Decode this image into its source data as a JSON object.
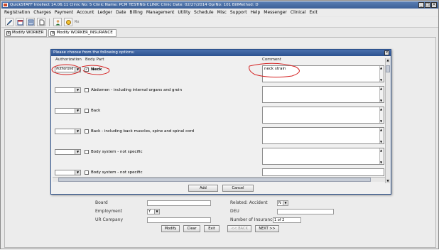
{
  "window": {
    "title": "QuickSTAFF Intellect 14.06.11 Clinic No: 5 Clinic Name: PCM TESTING CLINIC Clinic Date: 02/27/2014 OprNo: 101 BillMethod: D",
    "controls": [
      "_",
      "□",
      "×"
    ]
  },
  "menu": [
    "Registration",
    "Charges",
    "Payment",
    "Account",
    "Ledger",
    "Date",
    "Billing",
    "Management",
    "Utility",
    "Schedule",
    "Misc",
    "Support",
    "Help",
    "Messenger",
    "Clinical",
    "Exit"
  ],
  "toolbar": {
    "icons": [
      "pen-icon",
      "calendar-icon",
      "ledger-icon",
      "document-icon",
      "person-icon",
      "coins-icon"
    ],
    "extra_label": "Rx"
  },
  "tabs": [
    {
      "label": "Modify WORKER",
      "active": false
    },
    {
      "label": "Modify WORKER_INSURANCE",
      "active": true
    }
  ],
  "background_form": {
    "board_label": "Board",
    "related_accident_label": "Related: Accident",
    "related_accident_value": "N",
    "employment_label": "Employment",
    "employment_value": "Y",
    "deu_label": "DEU",
    "ur_company_label": "UR Company",
    "number_insurance_label": "Number of Insurance",
    "number_insurance_value": "1 of 2",
    "buttons": {
      "modify": "Modify",
      "clear": "Clear",
      "exit": "Exit",
      "back": "<< BACK",
      "next": "NEXT >>"
    }
  },
  "dialog": {
    "title": "Please choose from the following options:",
    "header_authorization": "Authorization",
    "header_body_part": "Body Part",
    "header_comment": "Comment",
    "rows": [
      {
        "authorization": "Authorized",
        "checked": true,
        "body_part": "Neck",
        "comment": "neck strain"
      },
      {
        "authorization": "",
        "checked": false,
        "body_part": "Abdomen - including internal organs and groin",
        "comment": ""
      },
      {
        "authorization": "",
        "checked": false,
        "body_part": "Back",
        "comment": ""
      },
      {
        "authorization": "",
        "checked": false,
        "body_part": "Back - including back muscles, spine and spinal cord",
        "comment": ""
      },
      {
        "authorization": "",
        "checked": false,
        "body_part": "Body system - not specific",
        "comment": ""
      },
      {
        "authorization": "",
        "checked": false,
        "body_part": "Body system - not specific",
        "comment": ""
      }
    ],
    "add_label": "Add",
    "cancel_label": "Cancel"
  },
  "colors": {
    "annotation_red": "#d42020",
    "title_blue": "#3b5f96",
    "dialog_title_blue": "#2c5290"
  }
}
